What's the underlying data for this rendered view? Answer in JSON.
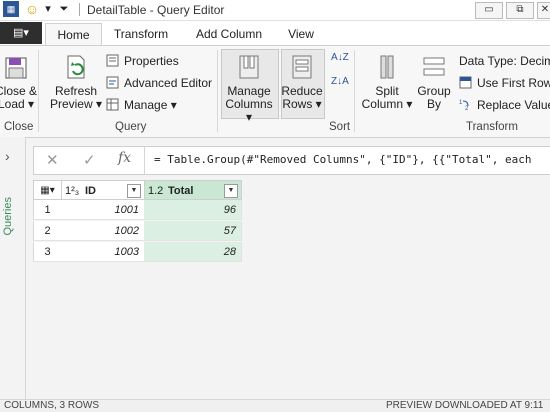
{
  "window": {
    "title": "DetailTable - Query Editor",
    "minimize_glyph": "▭",
    "restore_glyph": "⧉",
    "close_glyph": "✕"
  },
  "quick_access": {
    "smiley_glyph": "☺",
    "dropdown_glyph": "▾",
    "customize_glyph": "⏷"
  },
  "tabs": {
    "file_glyph": "▤▾",
    "items": [
      "Home",
      "Transform",
      "Add Column",
      "View"
    ],
    "active": "Home"
  },
  "ribbon": {
    "close_load": {
      "line1": "Close &",
      "line2": "Load ▾"
    },
    "refresh": {
      "line1": "Refresh",
      "line2": "Preview ▾"
    },
    "properties": "Properties",
    "advanced_editor": "Advanced Editor",
    "manage": "Manage ▾",
    "manage_columns": {
      "line1": "Manage",
      "line2": "Columns ▾"
    },
    "reduce_rows": {
      "line1": "Reduce",
      "line2": "Rows ▾"
    },
    "sort_az": "A↓Z",
    "sort_za": "Z↓A",
    "split_column": {
      "line1": "Split",
      "line2": "Column ▾"
    },
    "group_by": {
      "line1": "Group",
      "line2": "By"
    },
    "data_type": "Data Type: Decima",
    "use_first_row": "Use First Row",
    "replace_values": "Replace Value",
    "groups": {
      "close": "Close",
      "query": "Query",
      "sort": "Sort",
      "transform": "Transform"
    }
  },
  "queries_pane": {
    "label": "Queries",
    "expand_glyph": "›"
  },
  "formula_bar": {
    "cancel_glyph": "✕",
    "commit_glyph": "✓",
    "fx_glyph": "fx",
    "formula": "= Table.Group(#\"Removed Columns\", {\"ID\"}, {{\"Total\", each"
  },
  "table": {
    "columns": [
      {
        "type": "1²₃",
        "name": "ID"
      },
      {
        "type": "1.2",
        "name": "Total"
      }
    ],
    "rows": [
      {
        "num": "1",
        "id": "1001",
        "total": "96"
      },
      {
        "num": "2",
        "id": "1002",
        "total": "57"
      },
      {
        "num": "3",
        "id": "1003",
        "total": "28"
      }
    ],
    "header_icon_glyph": "▦▾",
    "dropdown_glyph": "▼"
  },
  "status": {
    "left": "COLUMNS, 3 ROWS",
    "right": "PREVIEW DOWNLOADED AT 9:11"
  },
  "colors": {
    "accent_green": "#c9e7d3",
    "dark_tab": "#2e2e2e"
  }
}
